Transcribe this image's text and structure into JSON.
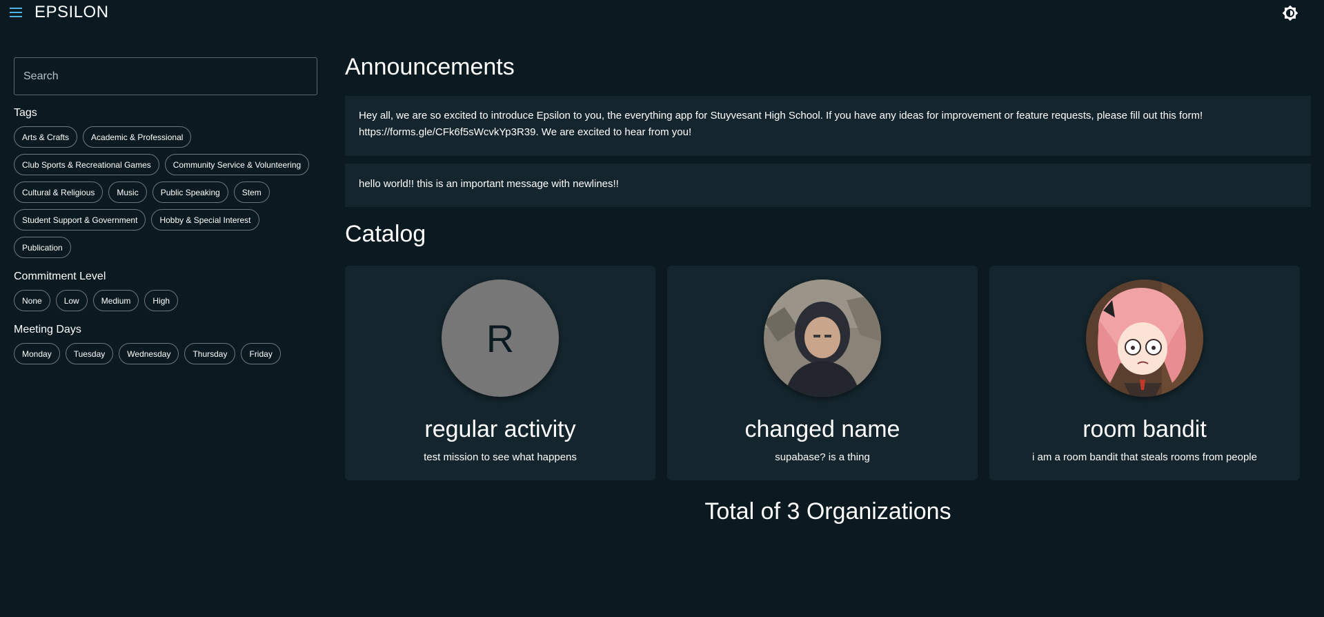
{
  "header": {
    "brand": "EPSILON",
    "menu_icon": "hamburger-menu-icon",
    "theme_icon": "brightness-icon"
  },
  "sidebar": {
    "search_placeholder": "Search",
    "tags_title": "Tags",
    "tags": [
      "Arts & Crafts",
      "Academic & Professional",
      "Club Sports & Recreational Games",
      "Community Service & Volunteering",
      "Cultural & Religious",
      "Music",
      "Public Speaking",
      "Stem",
      "Student Support & Government",
      "Hobby & Special Interest",
      "Publication"
    ],
    "commitment_title": "Commitment Level",
    "commitment": [
      "None",
      "Low",
      "Medium",
      "High"
    ],
    "days_title": "Meeting Days",
    "days": [
      "Monday",
      "Tuesday",
      "Wednesday",
      "Thursday",
      "Friday"
    ]
  },
  "main": {
    "announcements_title": "Announcements",
    "announcements": [
      "Hey all, we are so excited to introduce Epsilon to you, the everything app for Stuyvesant High School. If you have any ideas for improvement or feature requests, please fill out this form! https://forms.gle/CFk6f5sWcvkYp3R39. We are excited to hear from you!",
      "hello world!! this is an important message with newlines!!"
    ],
    "catalog_title": "Catalog",
    "organizations": [
      {
        "name": "regular activity",
        "description": "test mission to see what happens",
        "avatar_letter": "R"
      },
      {
        "name": "changed name",
        "description": "supabase? is a thing"
      },
      {
        "name": "room bandit",
        "description": "i am a room bandit that steals rooms from people"
      }
    ],
    "total_text": "Total of 3 Organizations"
  },
  "colors": {
    "background": "#0b1a21",
    "card": "#14252d",
    "accent": "#4fb3e8"
  }
}
